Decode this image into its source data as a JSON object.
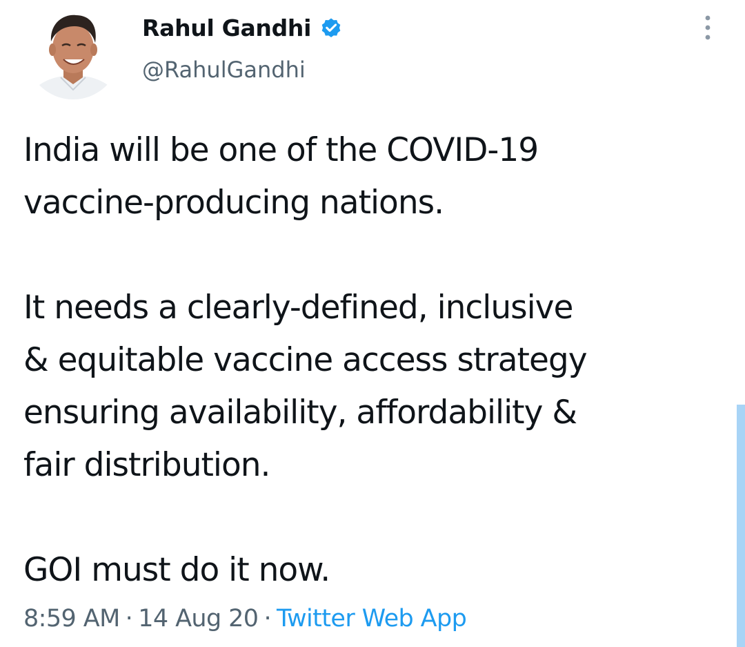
{
  "author": {
    "name": "Rahul Gandhi",
    "handle": "@RahulGandhi",
    "verified": true,
    "avatar_icon": "profile-photo"
  },
  "tweet": {
    "paragraphs": [
      [
        "India will be one of the COVID-19",
        "vaccine-producing nations."
      ],
      [
        "It needs a clearly-defined, inclusive",
        "& equitable vaccine access strategy",
        "ensuring availability, affordability &",
        "fair distribution."
      ],
      [
        "GOI must do it now."
      ]
    ]
  },
  "meta": {
    "time": "8:59 AM",
    "separator": "·",
    "date": "14 Aug 20",
    "source": "Twitter Web App"
  },
  "colors": {
    "text": "#0f1419",
    "secondary": "#536471",
    "accent": "#1d9bf0",
    "scrollbar": "#a8d4f6"
  },
  "icons": {
    "verified": "verified-badge-icon",
    "more": "more-options-icon"
  }
}
